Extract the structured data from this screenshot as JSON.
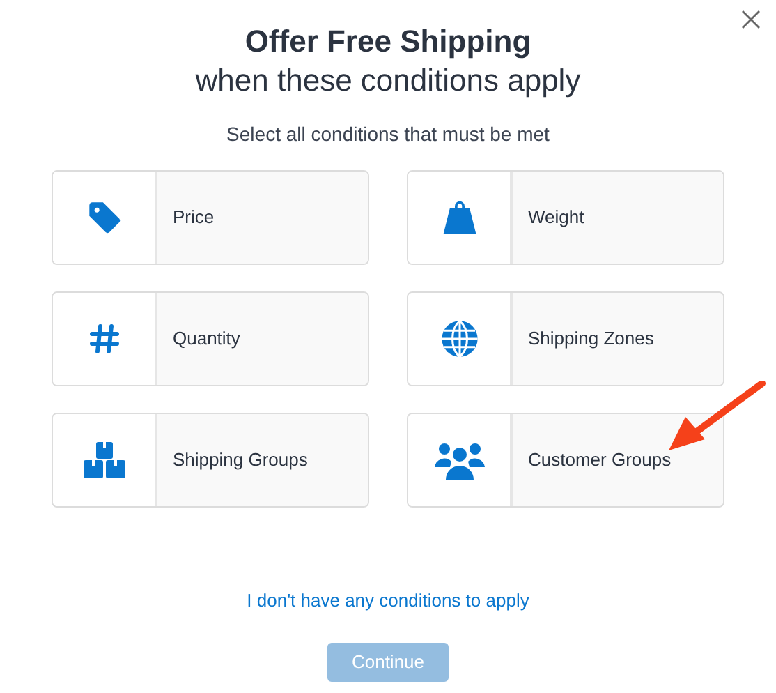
{
  "title": "Offer Free Shipping",
  "subtitle": "when these conditions apply",
  "instruction": "Select all conditions that must be met",
  "conditions": [
    {
      "label": "Price"
    },
    {
      "label": "Weight"
    },
    {
      "label": "Quantity"
    },
    {
      "label": "Shipping Zones"
    },
    {
      "label": "Shipping Groups"
    },
    {
      "label": "Customer Groups"
    }
  ],
  "no_conditions_link": "I don't have any conditions to apply",
  "continue_button": {
    "label": "Continue",
    "disabled": true
  }
}
